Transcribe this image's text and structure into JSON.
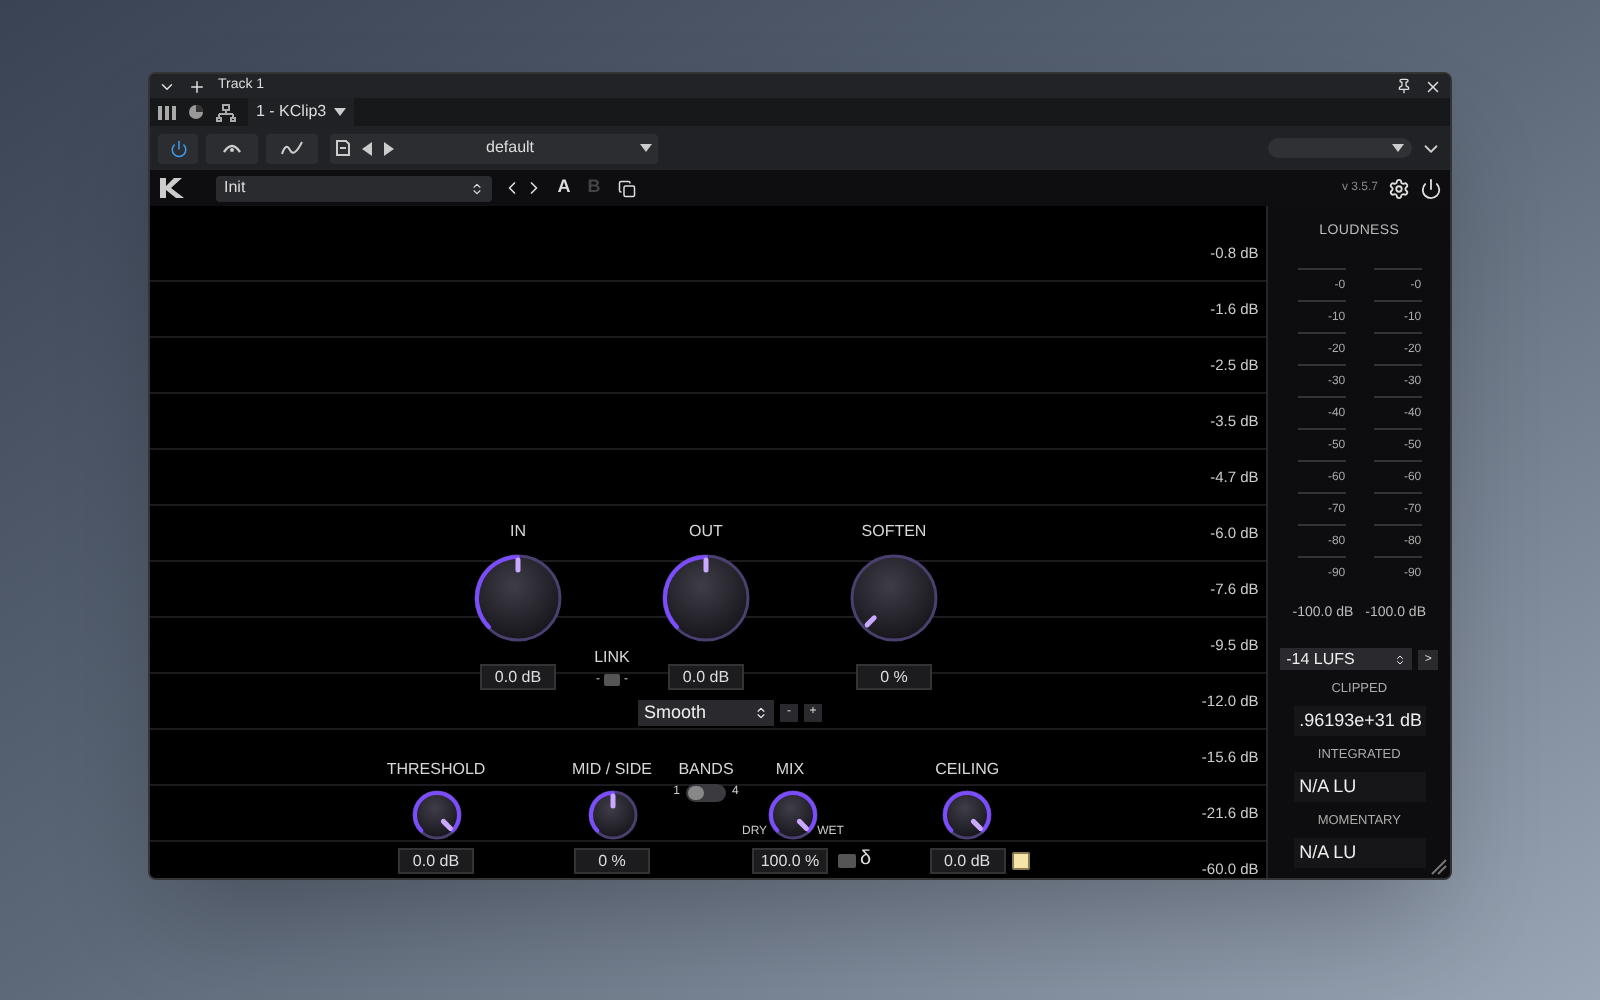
{
  "window": {
    "title": "Track 1"
  },
  "track_bar": {
    "plugin_slot": "1 - KClip3"
  },
  "toolbar": {
    "power_on": true,
    "preset": "default"
  },
  "plugin_header": {
    "preset": "Init",
    "compare": [
      {
        "label": "A",
        "disabled": false
      },
      {
        "label": "B",
        "disabled": true
      }
    ],
    "version": "v 3.5.7"
  },
  "scale_labels": [
    "-0.8 dB",
    "-1.6 dB",
    "-2.5 dB",
    "-3.5 dB",
    "-4.7 dB",
    "-6.0 dB",
    "-7.6 dB",
    "-9.5 dB",
    "-12.0 dB",
    "-15.6 dB",
    "-21.6 dB",
    "-60.0 dB"
  ],
  "knobs_top": [
    {
      "label": "IN",
      "value": "0.0 dB",
      "level": 0.5
    },
    {
      "label": "OUT",
      "value": "0.0 dB",
      "level": 0.5
    },
    {
      "label": "SOFTEN",
      "value": "0 %",
      "level": 0
    }
  ],
  "link": {
    "label": "LINK",
    "left": "-",
    "right": "-"
  },
  "mode": {
    "value": "Smooth",
    "minus": "-",
    "plus": "+"
  },
  "controls_bottom": [
    {
      "kind": "knob",
      "label": "THRESHOLD",
      "value": "0.0 dB",
      "level": 1
    },
    {
      "kind": "knob",
      "label": "MID / SIDE",
      "value": "0 %",
      "level": 0.5
    },
    {
      "kind": "toggle",
      "label": "BANDS",
      "min": "1",
      "max": "4",
      "on": false
    },
    {
      "kind": "mix",
      "label": "MIX",
      "dry": "DRY",
      "wet": "WET",
      "value": "100.0 %",
      "level": 1,
      "delta": "δ"
    },
    {
      "kind": "knob",
      "label": "CEILING",
      "value": "0.0 dB",
      "level": 1,
      "checked": true
    }
  ],
  "loudness": {
    "title": "LOUDNESS",
    "meters": [
      {
        "ticks": [
          "-0",
          "-10",
          "-20",
          "-30",
          "-40",
          "-50",
          "-60",
          "-70",
          "-80",
          "-90"
        ],
        "reading": "-100.0 dB"
      },
      {
        "ticks": [
          "-0",
          "-10",
          "-20",
          "-30",
          "-40",
          "-50",
          "-60",
          "-70",
          "-80",
          "-90"
        ],
        "reading": "-100.0 dB"
      }
    ],
    "target": "-14 LUFS",
    "next": ">",
    "stats": [
      {
        "label": "CLIPPED",
        "value": ".96193e+31 dB"
      },
      {
        "label": "INTEGRATED",
        "value": "N/A LU"
      },
      {
        "label": "MOMENTARY",
        "value": "N/A LU"
      }
    ]
  }
}
